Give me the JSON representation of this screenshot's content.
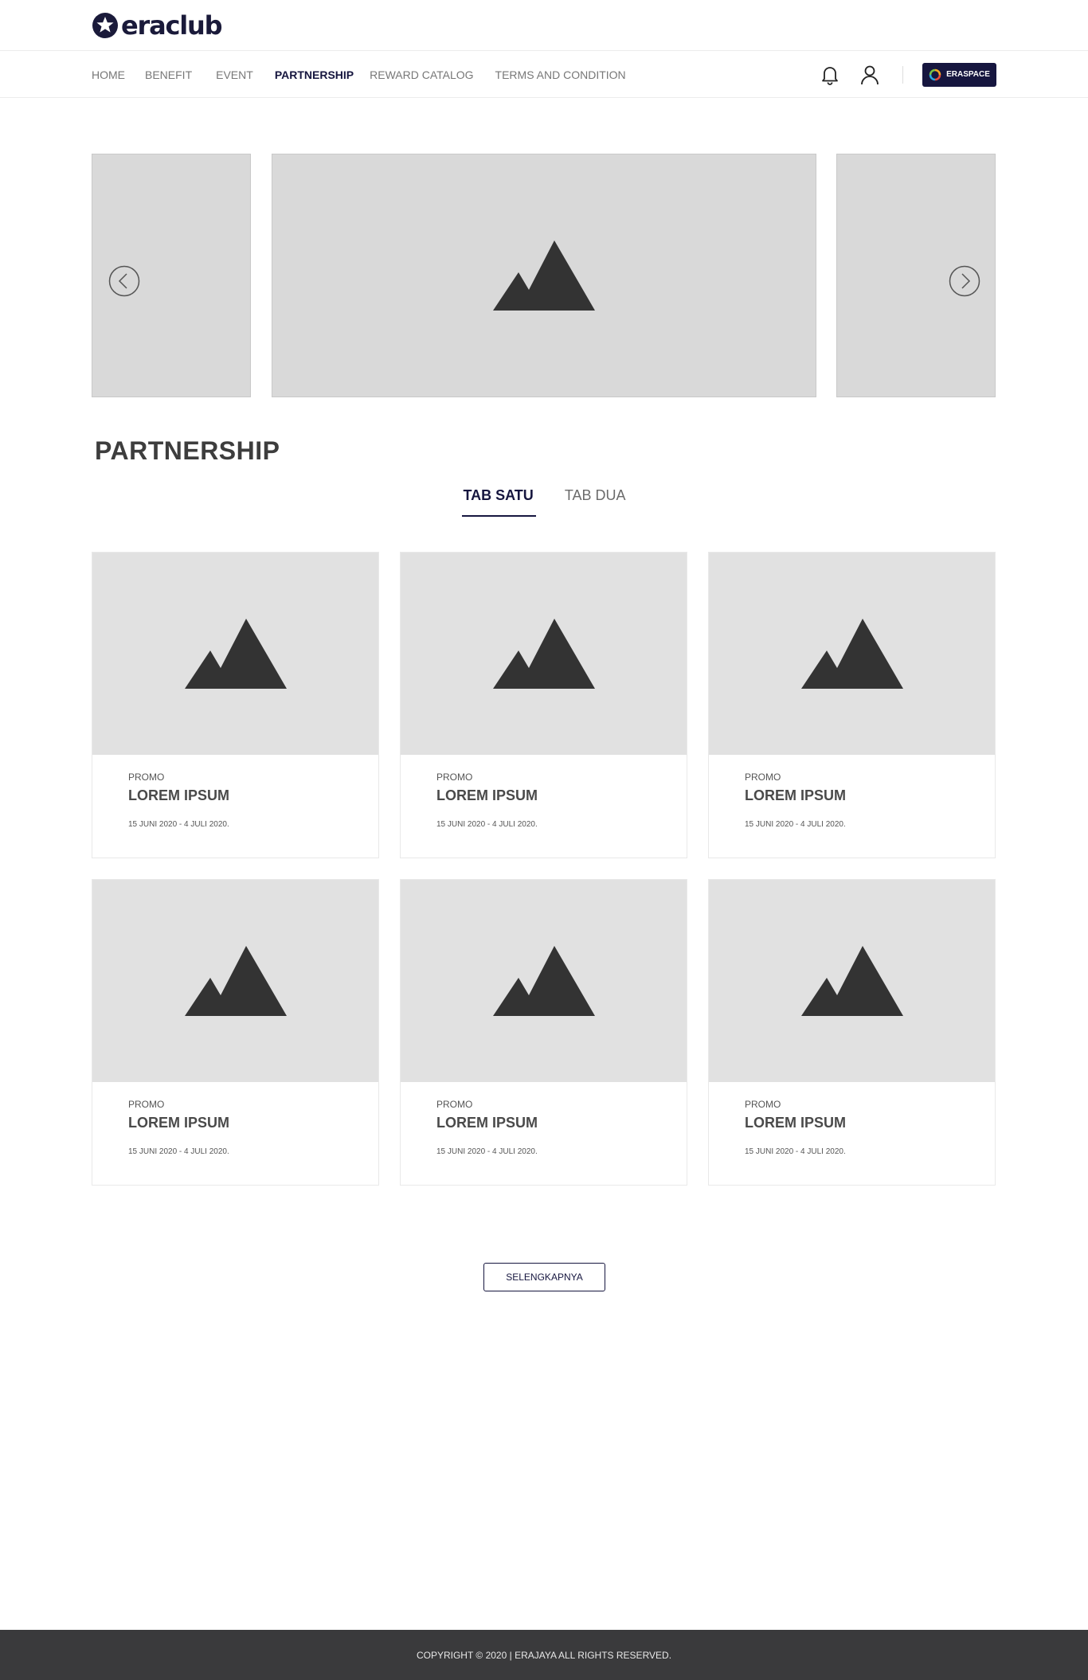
{
  "header": {
    "brand": "eraclub"
  },
  "nav": {
    "items": [
      "HOME",
      "BENEFIT",
      "EVENT",
      "PARTNERSHIP",
      "REWARD CATALOG",
      "TERMS AND CONDITION"
    ],
    "active": "PARTNERSHIP",
    "eraspace_label": "ERASPACE"
  },
  "section": {
    "title": "PARTNERSHIP"
  },
  "tabs": [
    "TAB SATU",
    "TAB DUA"
  ],
  "cards": [
    {
      "category": "PROMO",
      "title": "LOREM IPSUM",
      "date": "15 JUNI 2020 - 4 JULI 2020."
    },
    {
      "category": "PROMO",
      "title": "LOREM IPSUM",
      "date": "15 JUNI 2020 - 4 JULI 2020."
    },
    {
      "category": "PROMO",
      "title": "LOREM IPSUM",
      "date": "15 JUNI 2020 - 4 JULI 2020."
    },
    {
      "category": "PROMO",
      "title": "LOREM IPSUM",
      "date": "15 JUNI 2020 - 4 JULI 2020."
    },
    {
      "category": "PROMO",
      "title": "LOREM IPSUM",
      "date": "15 JUNI 2020 - 4 JULI 2020."
    },
    {
      "category": "PROMO",
      "title": "LOREM IPSUM",
      "date": "15 JUNI 2020 - 4 JULI 2020."
    }
  ],
  "more_button": "SELENGKAPNYA",
  "footer": {
    "copyright": "COPYRIGHT © 2020 | ERAJAYA ALL RIGHTS RESERVED."
  },
  "icons": {
    "logo": "star-logo-icon",
    "bell": "bell-icon",
    "user": "user-icon",
    "eraspace": "eraspace-ring-icon",
    "prev": "chevron-left-icon",
    "next": "chevron-right-icon",
    "placeholder": "image-placeholder-icon"
  },
  "colors": {
    "brand": "#16163f",
    "placeholder_bg": "#e1e1e1",
    "footer_bg": "#3a3a3c"
  }
}
